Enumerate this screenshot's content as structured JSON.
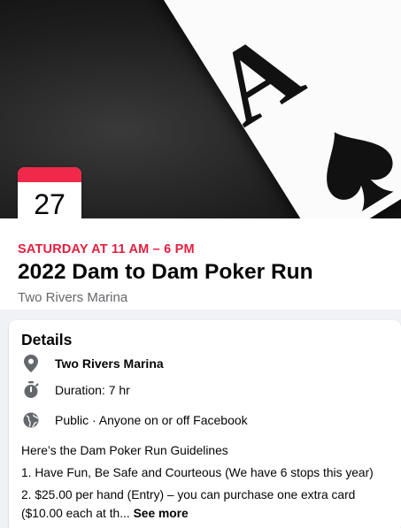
{
  "cover": {
    "card_letter": "A",
    "alt_icon": "ace-of-spades-card"
  },
  "date_badge": {
    "day": "27",
    "accent_color": "#f02849"
  },
  "event": {
    "when": "SATURDAY AT 11 AM – 6 PM",
    "title": "2022 Dam to Dam Poker Run",
    "venue": "Two Rivers Marina"
  },
  "details": {
    "heading": "Details",
    "location": "Two Rivers Marina",
    "duration": "Duration: 7 hr",
    "privacy": "Public · Anyone on or off Facebook",
    "description": [
      "Here’s the Dam Poker Run Guidelines",
      "1. Have Fun, Be Safe and Courteous (We have 6 stops this year)",
      "2. $25.00 per hand (Entry) – you can purchase one extra card ($10.00 each at th..."
    ],
    "see_more": "See more"
  },
  "icons": {
    "location": "map-pin-icon",
    "duration": "stopwatch-icon",
    "privacy": "globe-icon"
  },
  "colors": {
    "accent_red": "#e41e3f",
    "secondary_text": "#65676b",
    "icon_gray": "#65676b"
  }
}
